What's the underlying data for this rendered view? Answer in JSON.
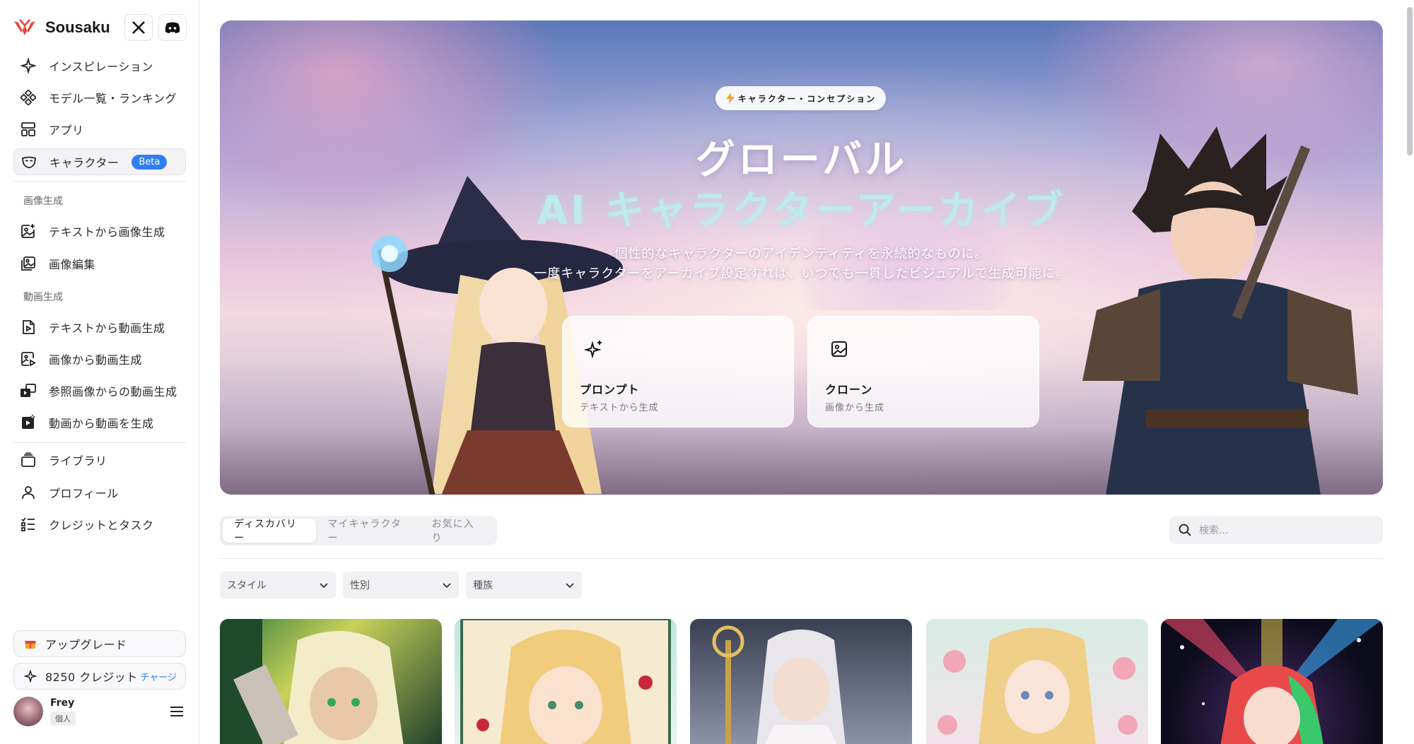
{
  "app": {
    "name": "Sousaku"
  },
  "sidebar": {
    "nav_top": [
      {
        "label": "インスピレーション",
        "icon": "sparkle-icon"
      },
      {
        "label": "モデル一覧・ランキング",
        "icon": "models-icon"
      },
      {
        "label": "アプリ",
        "icon": "apps-icon"
      },
      {
        "label": "キャラクター",
        "icon": "mask-icon",
        "badge": "Beta",
        "active": true
      }
    ],
    "section_image": "画像生成",
    "nav_image": [
      {
        "label": "テキストから画像生成",
        "icon": "text-to-image-icon"
      },
      {
        "label": "画像編集",
        "icon": "image-edit-icon"
      }
    ],
    "section_video": "動画生成",
    "nav_video": [
      {
        "label": "テキストから動画生成",
        "icon": "text-to-video-icon"
      },
      {
        "label": "画像から動画生成",
        "icon": "image-to-video-icon"
      },
      {
        "label": "参照画像からの動画生成",
        "icon": "reference-video-icon"
      },
      {
        "label": "動画から動画を生成",
        "icon": "video-to-video-icon"
      }
    ],
    "nav_bottom": [
      {
        "label": "ライブラリ",
        "icon": "library-icon"
      },
      {
        "label": "プロフィール",
        "icon": "user-icon"
      },
      {
        "label": "クレジットとタスク",
        "icon": "tasks-icon"
      }
    ],
    "upgrade_label": "アップグレード",
    "credits_label": "8250 クレジット",
    "charge_label": "チャージ",
    "user": {
      "name": "Frey",
      "tag": "個人"
    }
  },
  "hero": {
    "badge": "キャラクター・コンセプション",
    "title_line1": "グローバル",
    "title_line2": "AI キャラクターアーカイブ",
    "subtitle_line1": "個性的なキャラクターのアイデンティティを永続的なものに。",
    "subtitle_line2": "一度キャラクターをアーカイブ設定すれば、いつでも一貫したビジュアルで生成可能に。",
    "cards": [
      {
        "title": "プロンプト",
        "subtitle": "テキストから生成",
        "icon": "sparkle-icon"
      },
      {
        "title": "クローン",
        "subtitle": "画像から生成",
        "icon": "image-icon"
      }
    ]
  },
  "tabs": [
    "ディスカバリー",
    "マイキャラクター",
    "お気に入り"
  ],
  "active_tab": "ディスカバリー",
  "search": {
    "placeholder": "検索..."
  },
  "filters": [
    "スタイル",
    "性別",
    "種族"
  ],
  "colors": {
    "accent": "#2f7ff2",
    "brand": "#e8453c"
  }
}
